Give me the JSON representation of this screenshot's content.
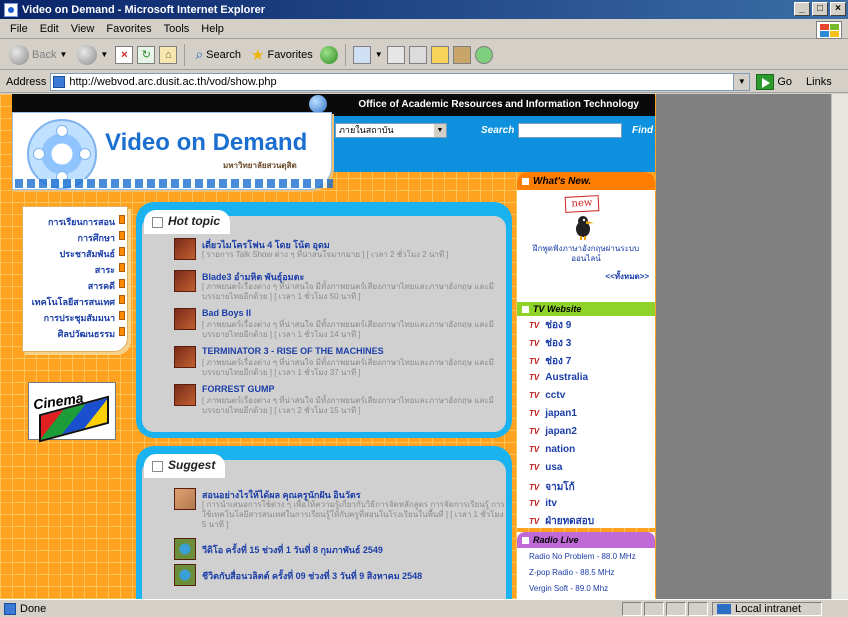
{
  "window": {
    "title": "Video on Demand - Microsoft Internet Explorer"
  },
  "menu": [
    "File",
    "Edit",
    "View",
    "Favorites",
    "Tools",
    "Help"
  ],
  "toolbar": {
    "back": "Back",
    "search": "Search",
    "favorites": "Favorites"
  },
  "address": {
    "label": "Address",
    "url": "http://webvod.arc.dusit.ac.th/vod/show.php",
    "go": "Go",
    "links": "Links"
  },
  "site": {
    "top_banner": "Office of Academic Resources and Information Technology",
    "logo_title": "Video on Demand",
    "logo_subtitle": "มหาวิทยาลัยสวนดุสิต",
    "search_scope": "ภายในสถาบัน",
    "search_label": "Search",
    "find_label": "Find"
  },
  "left_menu": [
    "การเรียนการสอน",
    "การศึกษา",
    "ประชาสัมพันธ์",
    "สาระ",
    "สารคดี",
    "เทคโนโลยีสารสนเทศ",
    "การประชุมสัมมนา",
    "ศิลปวัฒนธรรม"
  ],
  "cinema_label": "Cinema",
  "hot_topic": {
    "title": "Hot topic",
    "items": [
      {
        "title": "เดี่ยวไมโครโฟน 4 โดย โน้ต อุดม",
        "desc": "[ รายการ Talk Show ต่าง ๆ ที่น่าสนใจมากมาย ] [ เวลา 2 ชั่วโมง 2 นาที ]"
      },
      {
        "title": "Blade3 อำมหิต พันธุ์อมตะ",
        "desc": "[ ภาพยนตร์เรื่องต่าง ๆ ที่น่าสนใจ มีทั้งภาพยนตร์เสียงภาษาไทยและภาษาอังกฤษ และมีบรรยายไทยอีกด้วย ] [ เวลา 1 ชั่วโมง 50 นาที ]"
      },
      {
        "title": "Bad Boys II",
        "desc": "[ ภาพยนตร์เรื่องต่าง ๆ ที่น่าสนใจ มีทั้งภาพยนตร์เสียงภาษาไทยและภาษาอังกฤษ และมีบรรยายไทยอีกด้วย ] [ เวลา 1 ชั่วโมง 14 นาที ]"
      },
      {
        "title": "TERMINATOR 3 - RISE OF THE MACHINES",
        "desc": "[ ภาพยนตร์เรื่องต่าง ๆ ที่น่าสนใจ มีทั้งภาพยนตร์เสียงภาษาไทยและภาษาอังกฤษ และมีบรรยายไทยอีกด้วย ] [ เวลา 1 ชั่วโมง 37 นาที ]"
      },
      {
        "title": "FORREST GUMP",
        "desc": "[ ภาพยนตร์เรื่องต่าง ๆ ที่น่าสนใจ มีทั้งภาพยนตร์เสียงภาษาไทยและภาษาอังกฤษ และมีบรรยายไทยอีกด้วย ] [ เวลา 2 ชั่วโมง 15 นาที ]"
      }
    ]
  },
  "suggest": {
    "title": "Suggest",
    "items": [
      {
        "title": "สอนอย่างไรให้ได้ผล คุณครูนักฝัน อินวัตร",
        "desc": "[ การนำเสนอการใช้ต่าง ๆ เพื่อให้ความรู้เกี่ยวกับวิธีการจัดหลักสูตร การจัดการเรียนรู้ การใช้เทคโนโลยีสารสนเทศในการเรียนรู้ให้กับครูที่สอนในโรงเรียนในพื้นที่ ] [ เวลา 1 ชั่วโมง 5 นาที ]"
      },
      {
        "title": "วีดิโอ ครั้งที่ 15 ช่วงที่ 1 วันที่ 8 กุมภาพันธ์ 2549",
        "desc": ""
      },
      {
        "title": "ชีวิตกับสื่อนวลิตต์ ครั้งที่ 09 ช่วงที่ 3 วันที่ 9 สิงหาคม 2548",
        "desc": ""
      }
    ]
  },
  "whats_new": {
    "title": "What's New.",
    "badge": "new",
    "text": "ฝึกพูดฟังภาษาอังกฤษผ่านระบบออนไลน์",
    "more": "<<ทั้งหมด>>"
  },
  "tv_website": {
    "title": "TV Website",
    "items": [
      "ช่อง 9",
      "ช่อง 3",
      "ช่อง 7",
      "Australia",
      "cctv",
      "japan1",
      "japan2",
      "nation",
      "usa",
      "จามโก้",
      "itv",
      "ฝ่ายทดสอบ"
    ]
  },
  "radio_live": {
    "title": "Radio Live",
    "items": [
      "Radio No Problem - 88.0 MHz",
      "Z-pop Radio - 88.5 MHz",
      "Vergin Soft - 89.0 Mhz"
    ]
  },
  "status": {
    "text": "Done",
    "zone": "Local intranet"
  }
}
